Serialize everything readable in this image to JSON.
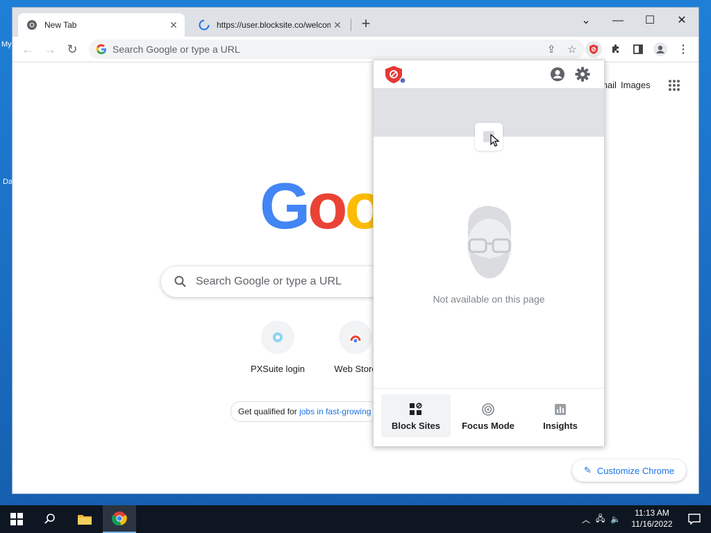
{
  "desktop": {
    "icon_labels": [
      "My",
      "Da"
    ]
  },
  "browser": {
    "tabs": [
      {
        "title": "New Tab",
        "active": true,
        "icon": "chrome-icon"
      },
      {
        "title": "https://user.blocksite.co/welcome",
        "active": false,
        "icon": "loading-icon"
      }
    ],
    "omnibox": {
      "placeholder": "Search Google or type a URL"
    }
  },
  "newtab": {
    "top_links": {
      "gmail": "Gmail",
      "images": "Images"
    },
    "logo_text": "Google",
    "search_placeholder": "Search Google or type a URL",
    "shortcuts": [
      {
        "label": "PXSuite login"
      },
      {
        "label": "Web Store"
      }
    ],
    "promo": {
      "prefix": "Get qualified for ",
      "link": "jobs in fast-growing"
    },
    "customize_label": "Customize Chrome"
  },
  "popup": {
    "message": "Not available on this page",
    "footer": [
      {
        "label": "Block Sites",
        "icon": "block-sites-icon",
        "active": true
      },
      {
        "label": "Focus Mode",
        "icon": "focus-target-icon",
        "active": false
      },
      {
        "label": "Insights",
        "icon": "insights-chart-icon",
        "active": false
      }
    ]
  },
  "taskbar": {
    "time": "11:13 AM",
    "date": "11/16/2022"
  },
  "colors": {
    "chrome_blue": "#1a73e8",
    "blocksite_red": "#e53935",
    "desktop_blue": "#1f7fd6"
  }
}
